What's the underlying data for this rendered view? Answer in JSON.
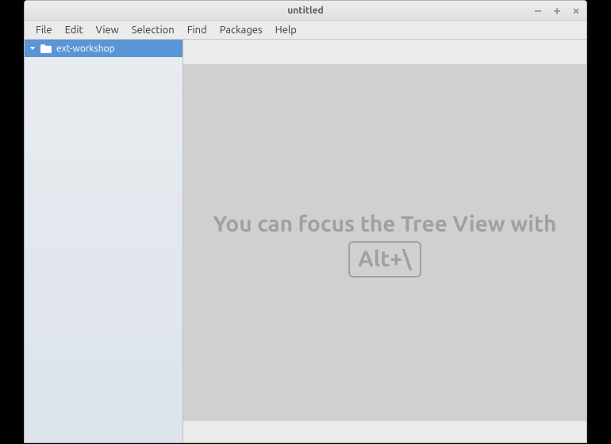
{
  "window": {
    "title": "untitled"
  },
  "menus": {
    "file": "File",
    "edit": "Edit",
    "view": "View",
    "selection": "Selection",
    "find": "Find",
    "packages": "Packages",
    "help": "Help"
  },
  "tree": {
    "root_label": "ext-workshop"
  },
  "editor": {
    "hint_prefix": "You can focus the Tree View with ",
    "hint_shortcut": "Alt+\\"
  }
}
